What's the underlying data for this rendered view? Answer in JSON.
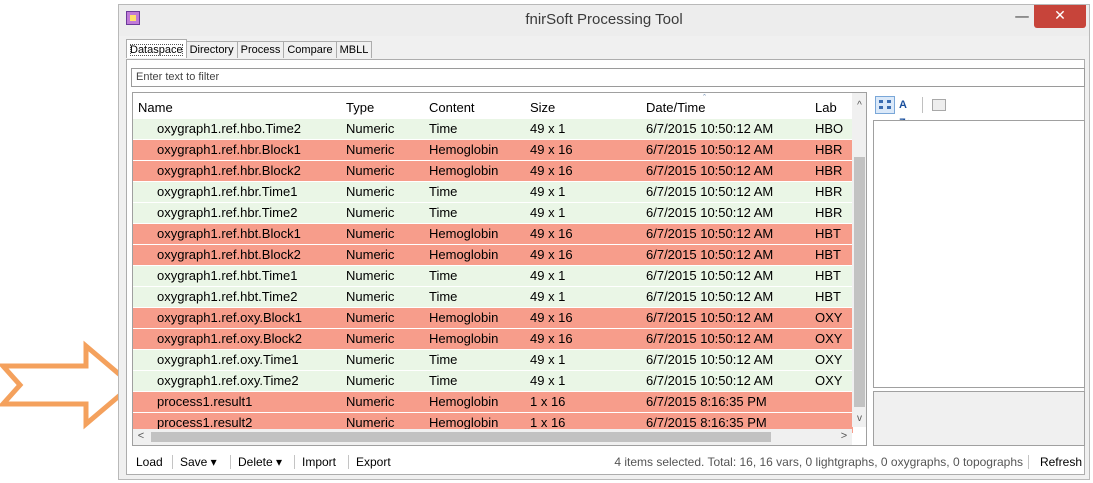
{
  "window": {
    "title": "fnirSoft Processing Tool",
    "minimize": "—",
    "maximize": "☐",
    "close": "✕"
  },
  "tabs": [
    "Dataspace",
    "Directory",
    "Process",
    "Compare",
    "MBLL"
  ],
  "filter": {
    "placeholder": "Enter text to filter"
  },
  "grid": {
    "columns": [
      "Name",
      "Type",
      "Content",
      "Size",
      "Date/Time",
      "Lab"
    ],
    "sort_indicator": "ˆ",
    "rows": [
      {
        "name": "oxygraph1.ref.hbo.Time2",
        "type": "Numeric",
        "content": "Time",
        "size": "49 x 1",
        "datetime": "6/7/2015 10:50:12 AM",
        "lab": "HBO",
        "status": "normal"
      },
      {
        "name": "oxygraph1.ref.hbr.Block1",
        "type": "Numeric",
        "content": "Hemoglobin",
        "size": "49 x 16",
        "datetime": "6/7/2015 10:50:12 AM",
        "lab": "HBR",
        "status": "selected"
      },
      {
        "name": "oxygraph1.ref.hbr.Block2",
        "type": "Numeric",
        "content": "Hemoglobin",
        "size": "49 x 16",
        "datetime": "6/7/2015 10:50:12 AM",
        "lab": "HBR",
        "status": "selected"
      },
      {
        "name": "oxygraph1.ref.hbr.Time1",
        "type": "Numeric",
        "content": "Time",
        "size": "49 x 1",
        "datetime": "6/7/2015 10:50:12 AM",
        "lab": "HBR",
        "status": "normal"
      },
      {
        "name": "oxygraph1.ref.hbr.Time2",
        "type": "Numeric",
        "content": "Time",
        "size": "49 x 1",
        "datetime": "6/7/2015 10:50:12 AM",
        "lab": "HBR",
        "status": "normal"
      },
      {
        "name": "oxygraph1.ref.hbt.Block1",
        "type": "Numeric",
        "content": "Hemoglobin",
        "size": "49 x 16",
        "datetime": "6/7/2015 10:50:12 AM",
        "lab": "HBT",
        "status": "selected"
      },
      {
        "name": "oxygraph1.ref.hbt.Block2",
        "type": "Numeric",
        "content": "Hemoglobin",
        "size": "49 x 16",
        "datetime": "6/7/2015 10:50:12 AM",
        "lab": "HBT",
        "status": "selected"
      },
      {
        "name": "oxygraph1.ref.hbt.Time1",
        "type": "Numeric",
        "content": "Time",
        "size": "49 x 1",
        "datetime": "6/7/2015 10:50:12 AM",
        "lab": "HBT",
        "status": "normal"
      },
      {
        "name": "oxygraph1.ref.hbt.Time2",
        "type": "Numeric",
        "content": "Time",
        "size": "49 x 1",
        "datetime": "6/7/2015 10:50:12 AM",
        "lab": "HBT",
        "status": "normal"
      },
      {
        "name": "oxygraph1.ref.oxy.Block1",
        "type": "Numeric",
        "content": "Hemoglobin",
        "size": "49 x 16",
        "datetime": "6/7/2015 10:50:12 AM",
        "lab": "OXY",
        "status": "selected"
      },
      {
        "name": "oxygraph1.ref.oxy.Block2",
        "type": "Numeric",
        "content": "Hemoglobin",
        "size": "49 x 16",
        "datetime": "6/7/2015 10:50:12 AM",
        "lab": "OXY",
        "status": "selected"
      },
      {
        "name": "oxygraph1.ref.oxy.Time1",
        "type": "Numeric",
        "content": "Time",
        "size": "49 x 1",
        "datetime": "6/7/2015 10:50:12 AM",
        "lab": "OXY",
        "status": "normal"
      },
      {
        "name": "oxygraph1.ref.oxy.Time2",
        "type": "Numeric",
        "content": "Time",
        "size": "49 x 1",
        "datetime": "6/7/2015 10:50:12 AM",
        "lab": "OXY",
        "status": "normal"
      },
      {
        "name": "process1.result1",
        "type": "Numeric",
        "content": "Hemoglobin",
        "size": "1 x 16",
        "datetime": "6/7/2015 8:16:35 PM",
        "lab": "",
        "status": "selected"
      },
      {
        "name": "process1.result2",
        "type": "Numeric",
        "content": "Hemoglobin",
        "size": "1 x 16",
        "datetime": "6/7/2015 8:16:35 PM",
        "lab": "",
        "status": "selected"
      }
    ]
  },
  "scroll": {
    "up": "^",
    "down": "v",
    "left": "<",
    "right": ">"
  },
  "props": {
    "alpha_sort": "A Z↓"
  },
  "toolbar": {
    "load": "Load",
    "save": "Save ▾",
    "delete": "Delete ▾",
    "import": "Import",
    "export": "Export",
    "status": "4 items selected. Total: 16, 16 vars, 0 lightgraphs, 0 oxygraphs, 0 topographs",
    "refresh": "Refresh"
  },
  "colors": {
    "hemoglobin_row": "#f79d8b",
    "time_row": "#eaf6e6",
    "arrow": "#f4a15d",
    "close_button": "#c7443a"
  }
}
